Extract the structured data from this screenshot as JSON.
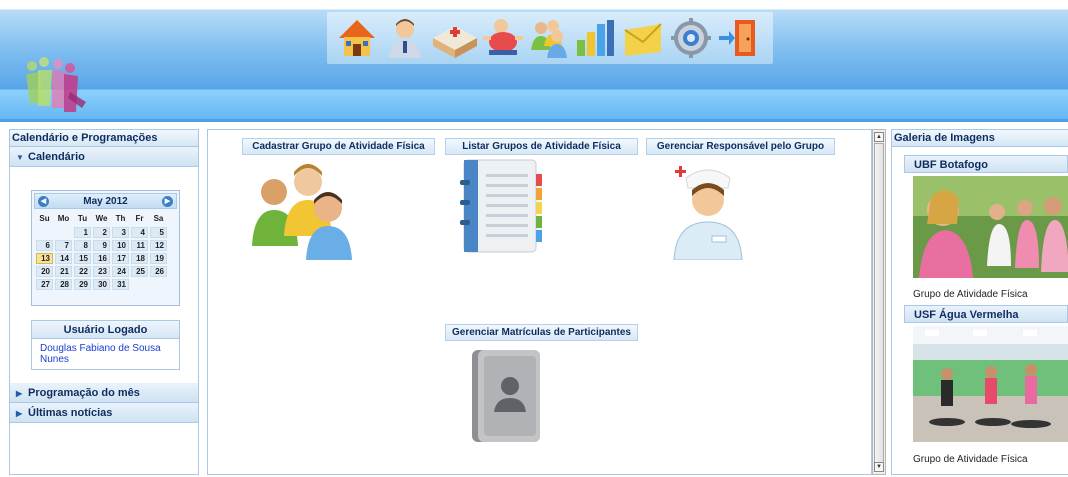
{
  "toolbar": {
    "icons": [
      "home-icon",
      "user-icon",
      "health-unit-icon",
      "activity-icon",
      "groups-icon",
      "reports-chart-icon",
      "messages-envelope-icon",
      "settings-gear-icon",
      "exit-door-icon"
    ]
  },
  "left_panel": {
    "title": "Calendário e Programações",
    "calendar_section": "Calendário",
    "calendar": {
      "month_label": "May 2012",
      "weekdays": [
        "Su",
        "Mo",
        "Tu",
        "We",
        "Th",
        "Fr",
        "Sa"
      ],
      "weeks": [
        [
          "",
          "",
          "1",
          "2",
          "3",
          "4",
          "5"
        ],
        [
          "6",
          "7",
          "8",
          "9",
          "10",
          "11",
          "12"
        ],
        [
          "13",
          "14",
          "15",
          "16",
          "17",
          "18",
          "19"
        ],
        [
          "20",
          "21",
          "22",
          "23",
          "24",
          "25",
          "26"
        ],
        [
          "27",
          "28",
          "29",
          "30",
          "31",
          "",
          ""
        ]
      ],
      "today": "13"
    },
    "user_box": {
      "title": "Usuário Logado",
      "name": "Douglas Fabiano de Sousa Nunes"
    },
    "programacao_section": "Programação do mês",
    "noticias_section": "Últimas notícias"
  },
  "center": {
    "tiles": {
      "cadastrar": "Cadastrar Grupo de Atividade Física",
      "listar": "Listar Grupos de Atividade Física",
      "responsavel": "Gerenciar Responsável pelo Grupo",
      "matriculas": "Gerenciar Matrículas de Participantes"
    }
  },
  "right_panel": {
    "title": "Galeria de Imagens",
    "items": [
      {
        "title": "UBF Botafogo",
        "caption": "Grupo de Atividade Física"
      },
      {
        "title": "USF Água Vermelha",
        "caption": "Grupo de Atividade Física"
      }
    ]
  },
  "colors": {
    "header_blue": "#63b5f3",
    "panel_border": "#a7c8e6",
    "heading_text": "#0e2d5f",
    "user_link": "#1a3dcf"
  }
}
